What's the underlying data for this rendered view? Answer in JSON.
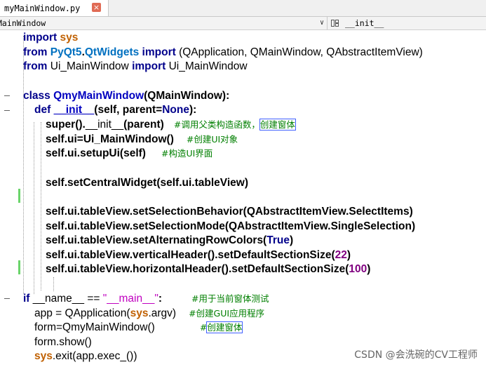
{
  "tab": {
    "filename": "myMainWindow.py",
    "close_glyph": "×"
  },
  "nav": {
    "class_selector": "MainWindow",
    "method_selector": "__init__",
    "chevron": "∨"
  },
  "watermark": "CSDN @会洗碗的CV工程师",
  "code": {
    "l1": {
      "a": "import",
      "b": " sys"
    },
    "l2": {
      "a": "from",
      "b": " PyQt5",
      "c": ".",
      "d": "QtWidgets",
      "e": " import ",
      "f": "(QApplication, QMainWindow, QAbstractItemView)"
    },
    "l3": {
      "a": "from",
      "b": " Ui_MainWindow ",
      "c": "import",
      "d": " Ui_MainWindow"
    },
    "l5": {
      "a": "class ",
      "b": "QmyMainWindow",
      "c": "(QMainWindow):"
    },
    "l6": {
      "a": "def ",
      "b": "__init__",
      "c": "(self, parent=",
      "d": "None",
      "e": "):"
    },
    "l7": {
      "a": "super().",
      "b": "__init__",
      "c": "(parent)",
      "cmt": "#调用父类构造函数，",
      "box": "创建窗体"
    },
    "l8": {
      "a": "self.ui=Ui_MainWindow()",
      "cmt": "#创建UI对象"
    },
    "l9": {
      "a": "self.ui.setupUi(self)",
      "cmt": "#构造UI界面"
    },
    "l11": {
      "a": "self.setCentralWidget(self.ui.tableView)"
    },
    "l13": {
      "a": "self.ui.tableView.setSelectionBehavior(QAbstractItemView.SelectItems)"
    },
    "l14": {
      "a": "self.ui.tableView.setSelectionMode(QAbstractItemView.SingleSelection)"
    },
    "l15": {
      "a": "self.ui.tableView.setAlternatingRowColors(",
      "b": "True",
      "c": ")"
    },
    "l16": {
      "a": "self.ui.tableView.verticalHeader().setDefaultSectionSize(",
      "b": "22",
      "c": ")"
    },
    "l17": {
      "a": "self.ui.tableView.horizontalHeader().setDefaultSectionSize(",
      "b": "100",
      "c": ")"
    },
    "l19": {
      "a": "if ",
      "b": "__name__ == ",
      "c": "\"__main__\"",
      "d": ":",
      "cmt": "#用于当前窗体测试"
    },
    "l20": {
      "a": "app = QApplication(",
      "b": "sys",
      "c": ".argv)",
      "cmt": "#创建GUI应用程序"
    },
    "l21": {
      "a": "form=QmyMainWindow()",
      "cmt": "#",
      "box": "创建窗体"
    },
    "l22": {
      "a": "form.show()"
    },
    "l23": {
      "a": "sys",
      "b": ".exit(app.exec_())"
    }
  }
}
